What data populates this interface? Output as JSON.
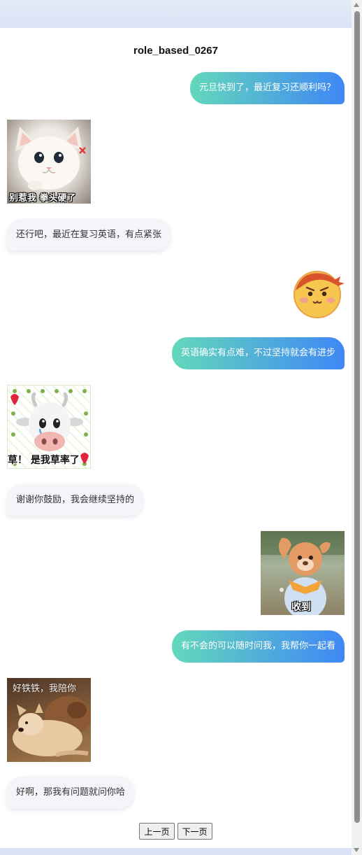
{
  "chat": {
    "title": "role_based_0267",
    "messages": [
      {
        "text": "元旦快到了，最近复习还顺利吗？"
      },
      {
        "caption": "别惹我 拳头硬了",
        "icon": "angry-cat-sticker"
      },
      {
        "text": "还行吧，最近在复习英语，有点紧张"
      },
      {
        "icon": "smiling-emoji-sticker"
      },
      {
        "text": "英语确实有点难，不过坚持就会有进步"
      },
      {
        "caption": "草！ 是我草率了",
        "icon": "cow-emoji-sticker"
      },
      {
        "text": "谢谢你鼓励，我会继续坚持的"
      },
      {
        "caption": "收到",
        "icon": "saluting-mascot-sticker"
      },
      {
        "text": "有不会的可以随时问我，我帮你一起看"
      },
      {
        "caption": "好铁铁，我陪你",
        "icon": "dogs-sticker"
      },
      {
        "text": "好啊，那我有问题就问你哈"
      }
    ]
  },
  "pagination": {
    "prev_label": "上一页",
    "next_label": "下一页"
  },
  "colors": {
    "sent_gradient_start": "#63d8bb",
    "sent_gradient_end": "#3f87f5",
    "received_bubble": "#f3f5f9",
    "page_background": "#dde6f5"
  }
}
